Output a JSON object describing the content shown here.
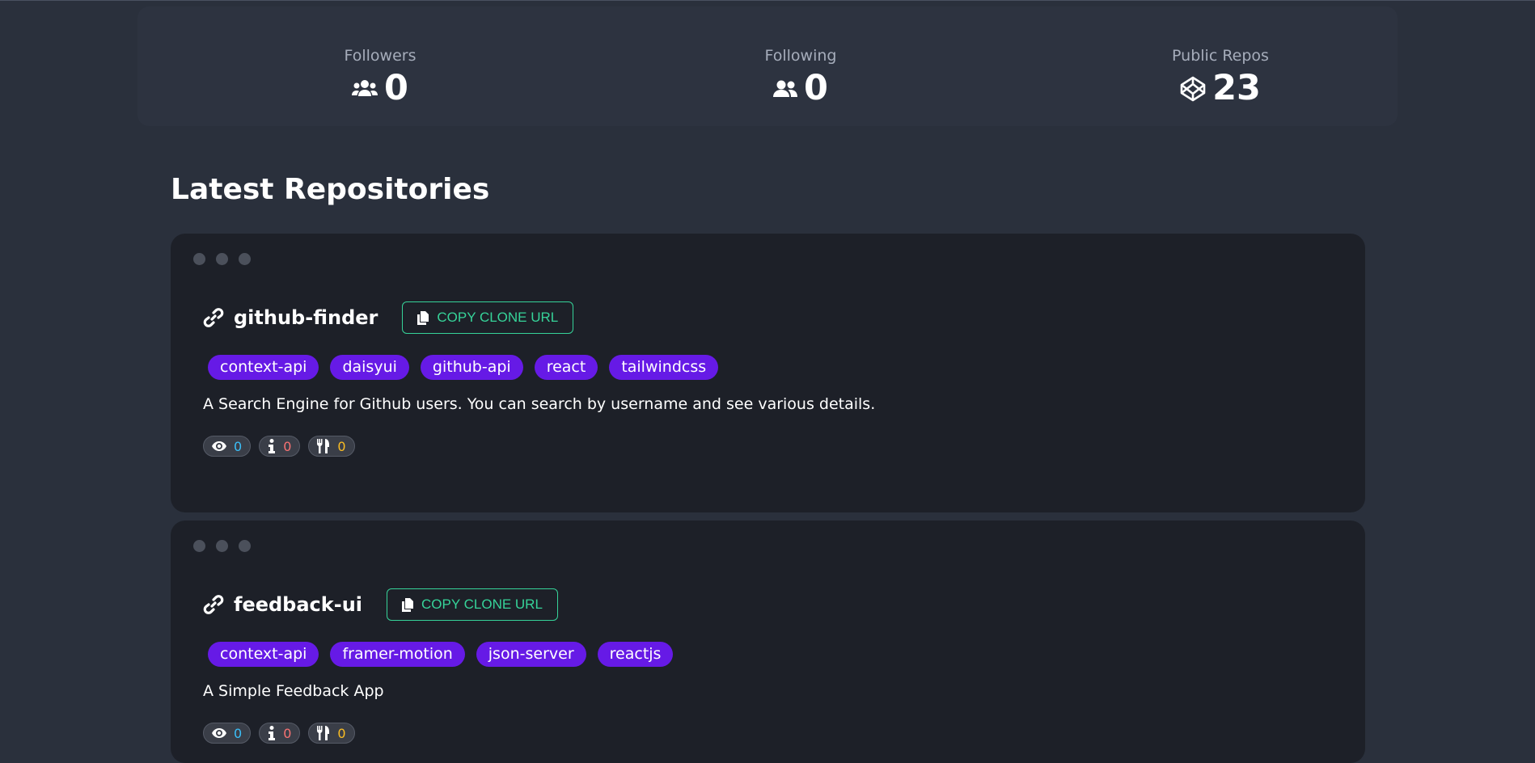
{
  "stats": [
    {
      "label": "Followers",
      "value": "0",
      "icon": "users-icon"
    },
    {
      "label": "Following",
      "value": "0",
      "icon": "user-friends-icon"
    },
    {
      "label": "Public Repos",
      "value": "23",
      "icon": "codepen-icon"
    }
  ],
  "section_title": "Latest Repositories",
  "copy_label": "COPY CLONE URL",
  "repos": [
    {
      "name": "github-finder",
      "topics": [
        "context-api",
        "daisyui",
        "github-api",
        "react",
        "tailwindcss"
      ],
      "description": "A Search Engine for Github users. You can search by username and see various details.",
      "watchers": "0",
      "issues": "0",
      "forks": "0"
    },
    {
      "name": "feedback-ui",
      "topics": [
        "context-api",
        "framer-motion",
        "json-server",
        "reactjs"
      ],
      "description": "A Simple Feedback App",
      "watchers": "0",
      "issues": "0",
      "forks": "0"
    }
  ],
  "colors": {
    "accent_green": "#36d399",
    "tag_purple": "#661ae6",
    "watch_blue": "#3abff8",
    "issue_red": "#f87272",
    "fork_yellow": "#fbbd23"
  }
}
